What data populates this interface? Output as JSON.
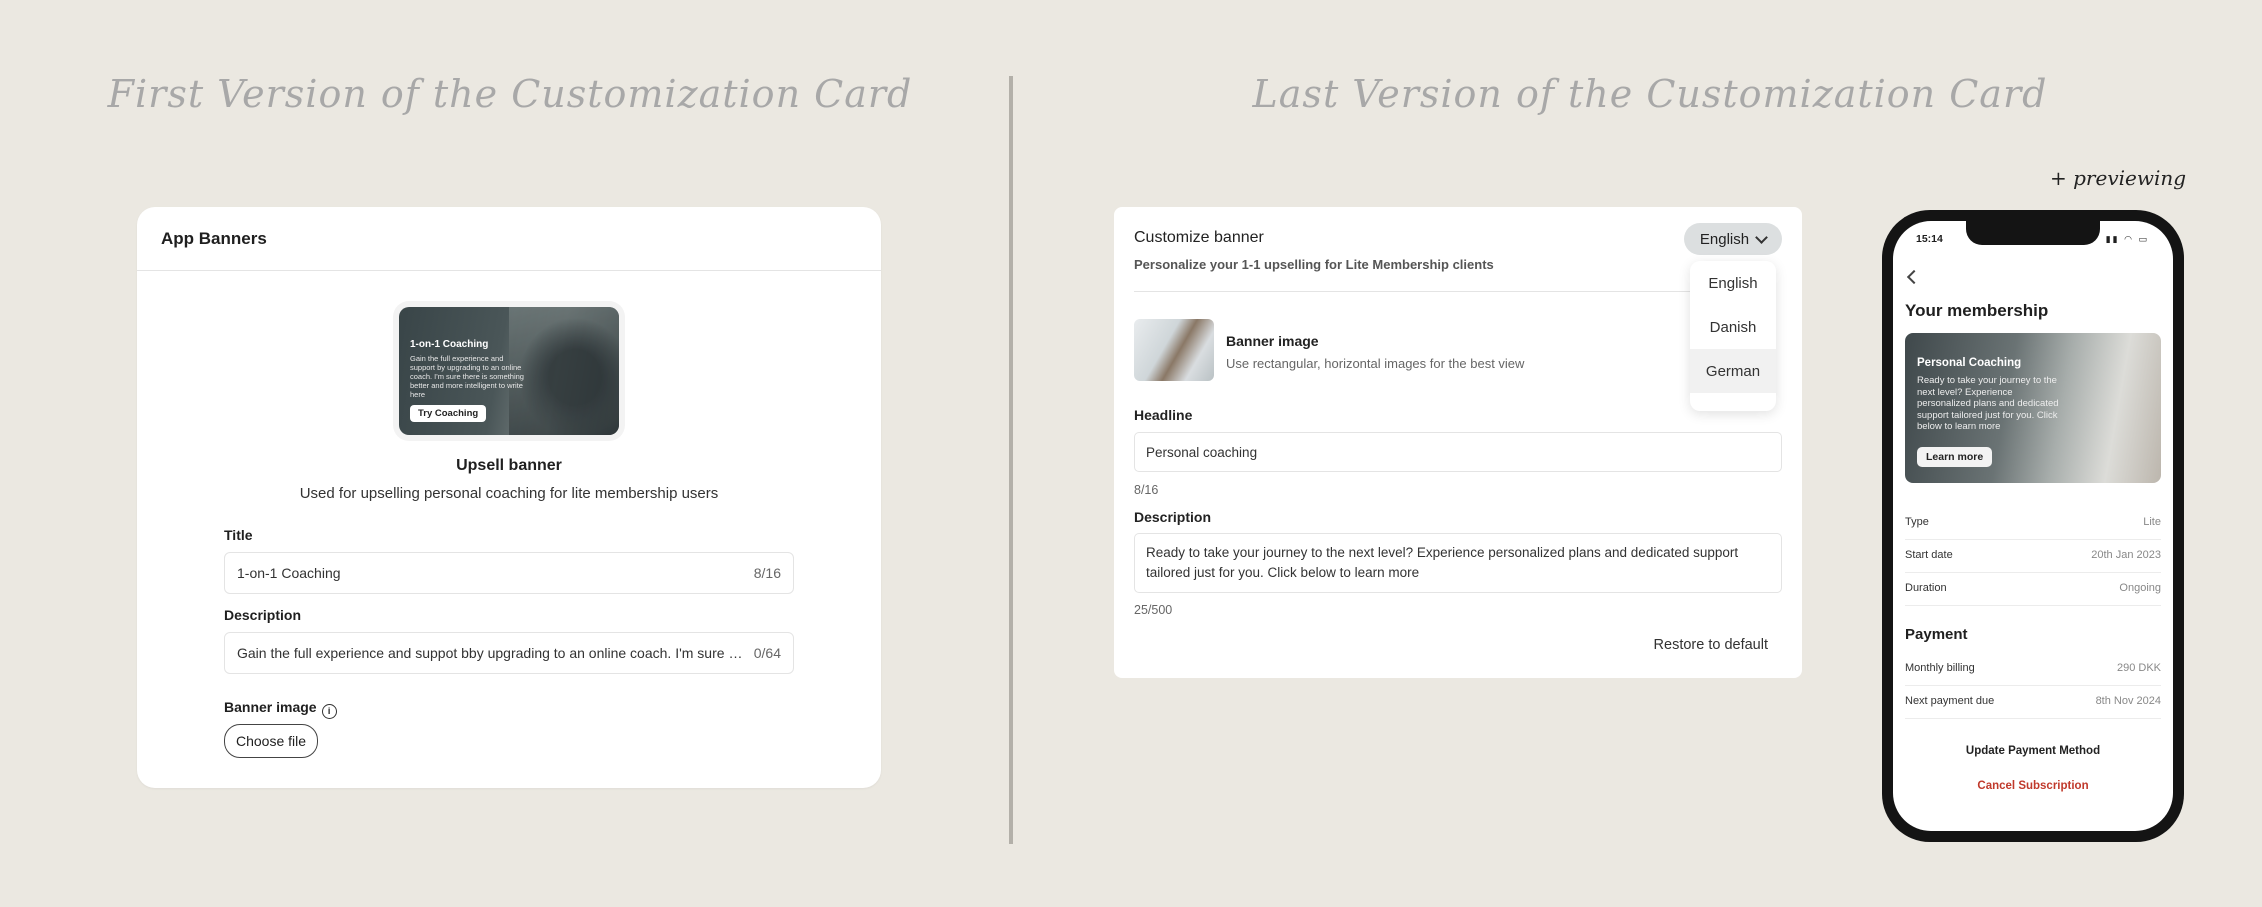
{
  "headings": {
    "left": "First Version of the Customization Card",
    "right": "Last Version of the Customization Card",
    "previewing": "+ previewing"
  },
  "first_card": {
    "title": "App Banners",
    "banner_preview": {
      "title": "1-on-1 Coaching",
      "description": "Gain the full experience and support by upgrading to an online coach. I'm sure there is something better and more intelligent to write here",
      "button": "Try Coaching"
    },
    "banner_name": "Upsell banner",
    "banner_desc": "Used for upselling personal coaching for lite membership users",
    "title_label": "Title",
    "title_value": "1-on-1 Coaching",
    "title_count": "8/16",
    "description_label": "Description",
    "description_value": "Gain the full experience and suppot bby upgrading to an online coach. I'm sure there is something better and more intelligent to write here",
    "description_count": "0/64",
    "image_label": "Banner image",
    "choose_file": "Choose file"
  },
  "last_card": {
    "title": "Customize banner",
    "subtitle": "Personalize your 1-1 upselling for Lite Membership clients",
    "language_selected": "English",
    "languages": [
      "English",
      "Danish",
      "German"
    ],
    "banner_image_label": "Banner image",
    "banner_image_hint": "Use rectangular, horizontal images for the best view",
    "headline_label": "Headline",
    "headline_value": "Personal coaching",
    "headline_count": "8/16",
    "description_label": "Description",
    "description_value": "Ready to take your journey to the next level? Experience personalized plans and dedicated support tailored just for you. Click below to learn more",
    "description_count": "25/500",
    "restore": "Restore to default"
  },
  "phone": {
    "time": "15:14",
    "title": "Your membership",
    "banner": {
      "title": "Personal Coaching",
      "description": "Ready to take your journey to the next level? Experience personalized plans and dedicated support tailored just for you. Click below to learn more",
      "button": "Learn more"
    },
    "rows": [
      {
        "key": "Type",
        "value": "Lite"
      },
      {
        "key": "Start date",
        "value": "20th Jan 2023"
      },
      {
        "key": "Duration",
        "value": "Ongoing"
      }
    ],
    "payment_title": "Payment",
    "payment_rows": [
      {
        "key": "Monthly billing",
        "value": "290 DKK"
      },
      {
        "key": "Next payment due",
        "value": "8th Nov 2024"
      }
    ],
    "update_payment": "Update Payment Method",
    "cancel": "Cancel Subscription"
  }
}
